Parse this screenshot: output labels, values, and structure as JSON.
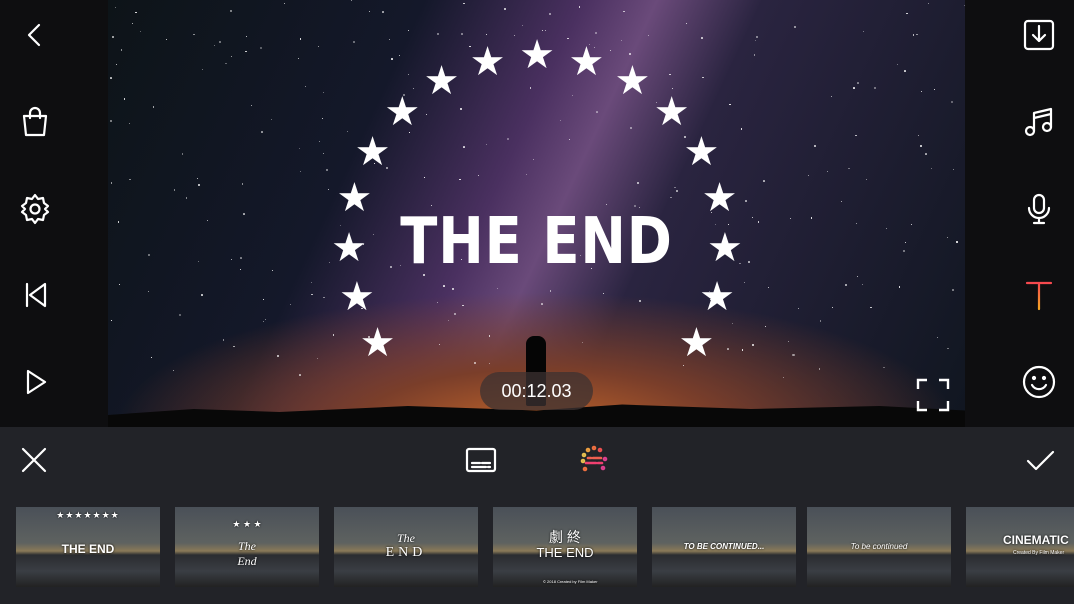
{
  "left_toolbar": [
    {
      "icon": "back-icon"
    },
    {
      "icon": "shopping-bag-icon"
    },
    {
      "icon": "gear-icon"
    },
    {
      "icon": "skip-to-start-icon"
    },
    {
      "icon": "play-icon"
    }
  ],
  "right_toolbar": [
    {
      "icon": "download-icon"
    },
    {
      "icon": "music-note-icon"
    },
    {
      "icon": "microphone-icon"
    },
    {
      "icon": "text-icon"
    },
    {
      "icon": "smiley-icon"
    }
  ],
  "preview": {
    "title_text": "THE END",
    "timestamp": "00:12.03"
  },
  "bottom_toolbar": {
    "close": "close-icon",
    "subtitle": "subtitle-icon",
    "effect": "animated-text-icon",
    "confirm": "check-icon"
  },
  "colors": {
    "text_icon_top": "#f6484f",
    "text_icon_bottom": "#f5a623",
    "panel": "#222328"
  },
  "templates": [
    {
      "lines": [
        "THE END"
      ]
    },
    {
      "lines": [
        "The",
        "End"
      ]
    },
    {
      "lines": [
        "The",
        "END"
      ]
    },
    {
      "lines": [
        "劇 終",
        "THE END",
        "© 2018 Created by Film Maker"
      ]
    },
    {
      "lines": [
        "TO BE CONTINUED..."
      ]
    },
    {
      "lines": [
        "To be continued"
      ]
    },
    {
      "lines": [
        "CINEMATIC",
        "Created By Film Maker"
      ]
    }
  ]
}
